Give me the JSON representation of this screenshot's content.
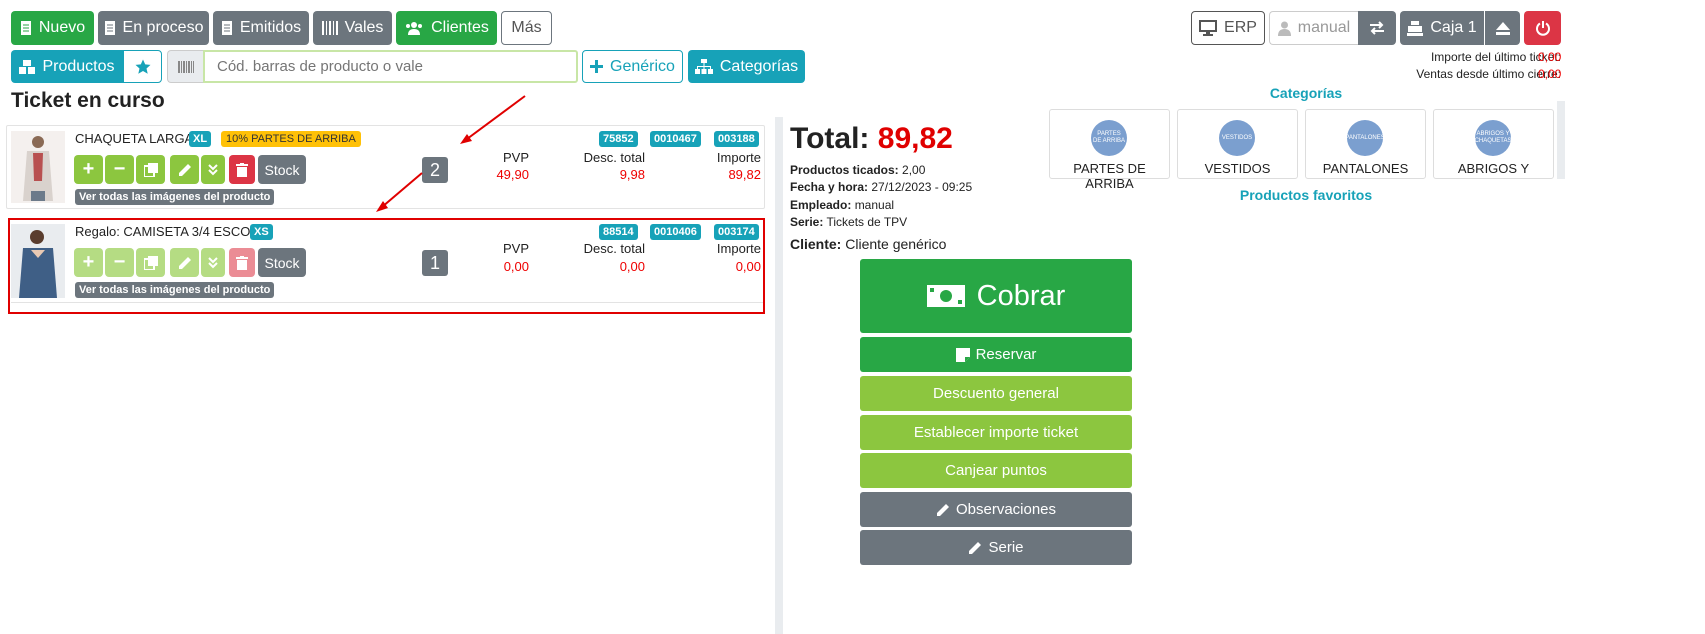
{
  "toolbar": {
    "nuevo": "Nuevo",
    "en_proceso": "En proceso",
    "emitidos": "Emitidos",
    "vales": "Vales",
    "clientes": "Clientes",
    "mas": "Más"
  },
  "top_right": {
    "erp": "ERP",
    "user": "manual",
    "caja": "Caja 1",
    "importe_label": "Importe del último ticket:",
    "importe_value": "0,00",
    "ventas_label": "Ventas desde último cierre:",
    "ventas_value": "0,00"
  },
  "search_row": {
    "productos": "Productos",
    "placeholder": "Cód. barras de producto o vale",
    "generico": "Genérico",
    "categorias": "Categorías"
  },
  "ticket": {
    "title": "Ticket en curso",
    "col_pvp": "PVP",
    "col_desc": "Desc. total",
    "col_importe": "Importe",
    "stock_label": "Stock",
    "images_label": "Ver todas las imágenes del producto",
    "lines": [
      {
        "name": "CHAQUETA LARGA",
        "size": "XL",
        "promo": "10% PARTES DE ARRIBA",
        "code1": "75852",
        "code2": "0010467",
        "code3": "003188",
        "qty": "2",
        "pvp": "49,90",
        "desc": "9,98",
        "importe": "89,82"
      },
      {
        "name": "Regalo: CAMISETA 3/4 ESCOTE",
        "size": "XS",
        "code1": "88514",
        "code2": "0010406",
        "code3": "003174",
        "qty": "1",
        "pvp": "0,00",
        "desc": "0,00",
        "importe": "0,00"
      }
    ]
  },
  "summary": {
    "total_label": "Total:",
    "total_value": "89,82",
    "productos_label": "Productos ticados:",
    "productos_value": "2,00",
    "fecha_label": "Fecha y hora:",
    "fecha_value": "27/12/2023 - 09:25",
    "empleado_label": "Empleado:",
    "empleado_value": "manual",
    "serie_label": "Serie:",
    "serie_value": "Tickets de TPV",
    "cliente_label": "Cliente:",
    "cliente_value": "Cliente genérico"
  },
  "actions": {
    "cobrar": "Cobrar",
    "reservar": "Reservar",
    "descuento": "Descuento general",
    "establecer": "Establecer importe ticket",
    "canjear": "Canjear puntos",
    "observaciones": "Observaciones",
    "serie": "Serie"
  },
  "categories": {
    "title": "Categorías",
    "favorites_title": "Productos favoritos",
    "items": [
      {
        "label": "PARTES DE ARRIBA",
        "circle": "PARTES DE ARRIBA"
      },
      {
        "label": "VESTIDOS",
        "circle": "VESTIDOS"
      },
      {
        "label": "PANTALONES",
        "circle": "PANTALONES"
      },
      {
        "label": "ABRIGOS Y",
        "circle": "ABRIGOS Y CHAQUETAS"
      }
    ]
  },
  "colors": {
    "green": "#28a745",
    "grey": "#6c757d",
    "teal": "#17a2b8",
    "lime": "#8cc63f",
    "red": "#dc3545",
    "highlight": "#e00000"
  }
}
